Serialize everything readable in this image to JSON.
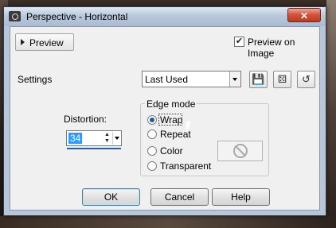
{
  "window": {
    "title": "Perspective - Horizontal",
    "close_glyph": "✕"
  },
  "preview": {
    "button_label": "Preview",
    "preview_on_image_label": "Preview on Image",
    "preview_on_image_checked": true
  },
  "settings": {
    "label": "Settings",
    "selected": "Last Used",
    "tools": [
      "save-preset-icon",
      "randomize-icon",
      "reset-icon"
    ]
  },
  "distortion": {
    "label": "Distortion:",
    "value": "34"
  },
  "edge_mode": {
    "title": "Edge mode",
    "options": [
      "Wrap",
      "Repeat",
      "Color",
      "Transparent"
    ],
    "selected": "Wrap"
  },
  "buttons": {
    "ok": "OK",
    "cancel": "Cancel",
    "help": "Help"
  }
}
